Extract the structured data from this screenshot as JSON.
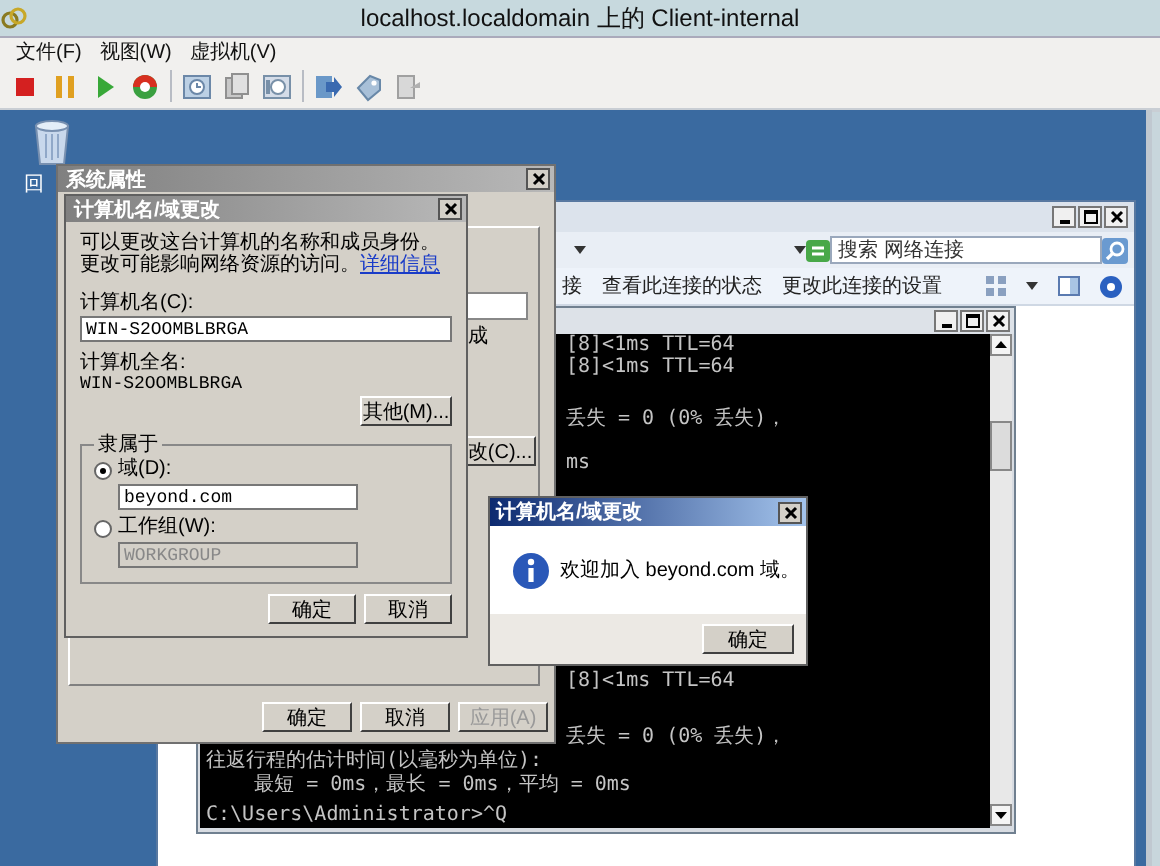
{
  "window": {
    "title": "localhost.localdomain 上的 Client-internal"
  },
  "menu": [
    "文件(F)",
    "视图(W)",
    "虚拟机(V)"
  ],
  "desktop_icons": [
    {
      "label": "回"
    }
  ],
  "network_window": {
    "search": {
      "placeholder": "搜索 网络连接"
    },
    "commands": [
      "接",
      "查看此连接的状态",
      "更改此连接的设置"
    ]
  },
  "console": {
    "lines": [
      {
        "text": "[8]<1ms TTL=64",
        "kind": "clipped"
      },
      {
        "text": "[8]<1ms TTL=64",
        "kind": "clipped"
      },
      {
        "text": "丢失 = 0 (0% 丢失)，",
        "kind": "clipped"
      },
      {
        "text": "ms",
        "kind": "clipped"
      },
      {
        "text": "[8]<1ms TTL=64",
        "kind": "clipped"
      },
      {
        "text": "丢失 = 0 (0% 丢失)，",
        "kind": "clipped"
      },
      {
        "text": "往返行程的估计时间(以毫秒为单位):",
        "kind": "full"
      },
      {
        "text": "    最短 = 0ms，最长 = 0ms，平均 = 0ms",
        "kind": "full"
      },
      {
        "text": "C:\\Users\\Administrator>^Q",
        "kind": "full"
      }
    ]
  },
  "system_properties": {
    "title": "系统属性",
    "side_text": "成",
    "side_button": "改(C)...",
    "buttons": [
      {
        "label": "确定",
        "disabled": false
      },
      {
        "label": "取消",
        "disabled": false
      },
      {
        "label": "应用(A)",
        "disabled": true
      }
    ]
  },
  "name_dialog": {
    "title": "计算机名/域更改",
    "intro": "可以更改这台计算机的名称和成员身份。更改可能影响网络资源的访问。",
    "link": "详细信息",
    "computer_name": {
      "label": "计算机名(C):",
      "value": "WIN-S2OOMBLBRGA"
    },
    "full_name": {
      "label": "计算机全名:",
      "value": "WIN-S2OOMBLBRGA"
    },
    "more_button": "其他(M)...",
    "member_of": {
      "title": "隶属于",
      "options": [
        {
          "label": "域(D):",
          "selected": true,
          "value": "beyond.com"
        },
        {
          "label": "工作组(W):",
          "selected": false,
          "value": "WORKGROUP"
        }
      ]
    },
    "buttons": [
      "确定",
      "取消"
    ]
  },
  "message_box": {
    "title": "计算机名/域更改",
    "message": "欢迎加入 beyond.com 域。",
    "button": "确定"
  }
}
